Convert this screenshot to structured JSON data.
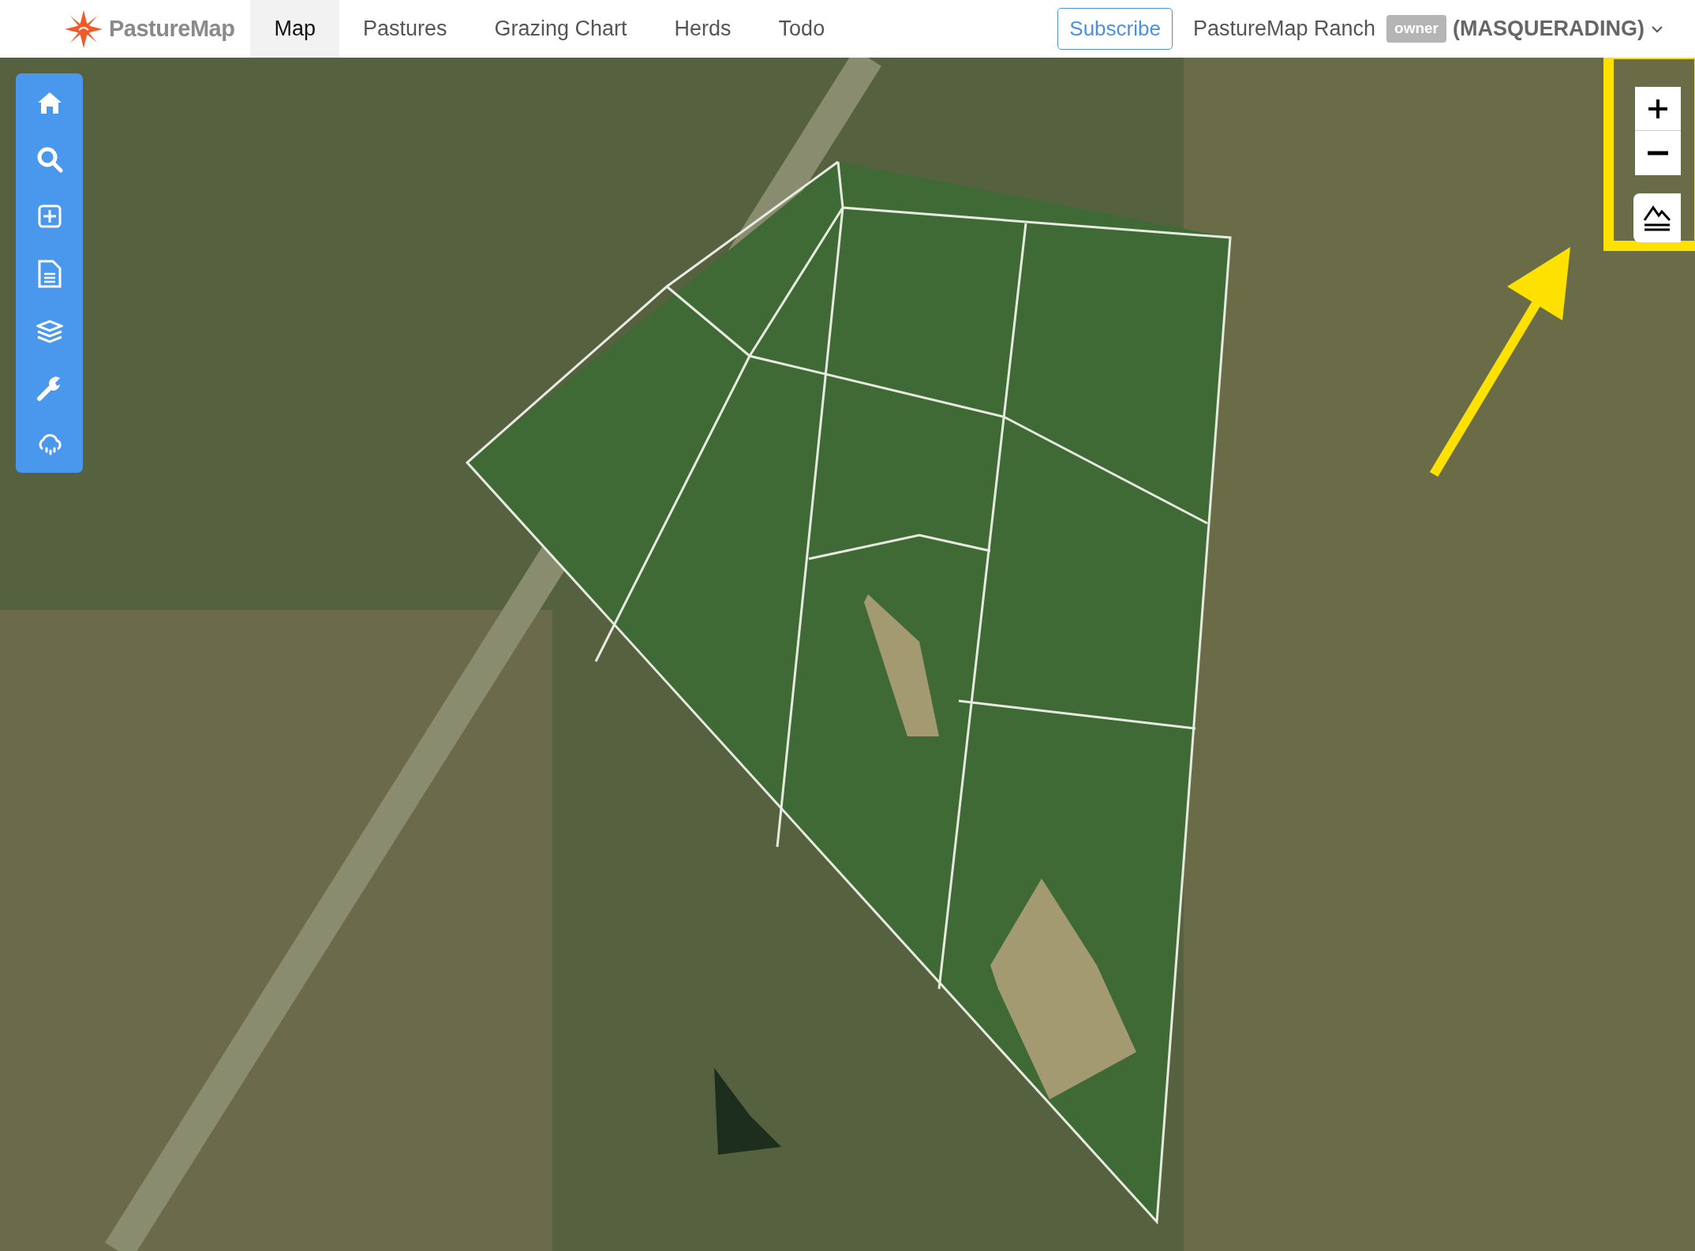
{
  "brand": {
    "name": "PastureMap"
  },
  "tabs": [
    {
      "label": "Map",
      "selected": true
    },
    {
      "label": "Pastures",
      "selected": false
    },
    {
      "label": "Grazing Chart",
      "selected": false
    },
    {
      "label": "Herds",
      "selected": false
    },
    {
      "label": "Todo",
      "selected": false
    }
  ],
  "subscribe_button": "Subscribe",
  "account": {
    "ranch": "PastureMap Ranch",
    "role_badge": "owner",
    "mode": "(MASQUERADING)"
  }
}
